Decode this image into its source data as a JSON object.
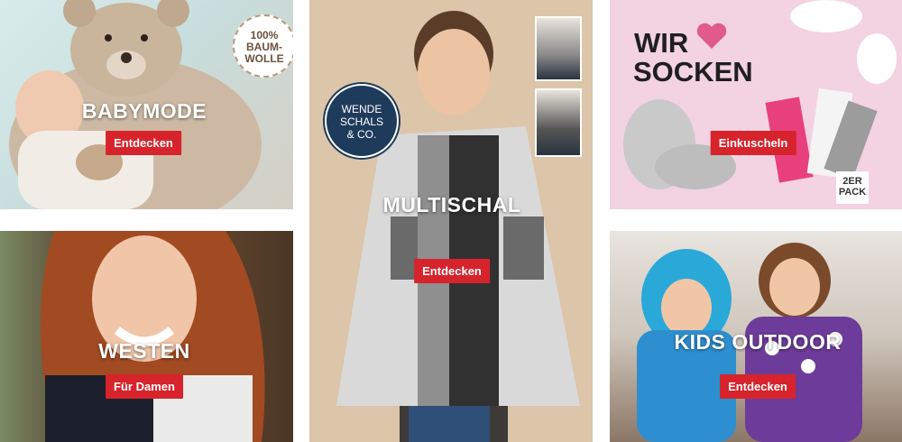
{
  "tiles": {
    "babymode": {
      "title": "BABYMODE",
      "cta": "Entdecken",
      "badge_lines": [
        "100%",
        "BAUM-",
        "WOLLE"
      ]
    },
    "westen": {
      "title": "WESTEN",
      "cta": "Für Damen"
    },
    "multischal": {
      "title": "MULTISCHAL",
      "cta": "Entdecken",
      "badge_lines": [
        "WENDE",
        "SCHALS",
        "& CO."
      ]
    },
    "socken": {
      "headline_1": "WIR",
      "headline_2": "SOCKEN",
      "cta": "Einkuscheln",
      "pack_badge_lines": [
        "2ER",
        "PACK"
      ]
    },
    "kids": {
      "title": "KIDS OUTDOOR",
      "cta": "Entdecken"
    }
  },
  "colors": {
    "cta": "#d7232b",
    "heart": "#e05a8a",
    "badge_navy": "#1f3b5c"
  }
}
